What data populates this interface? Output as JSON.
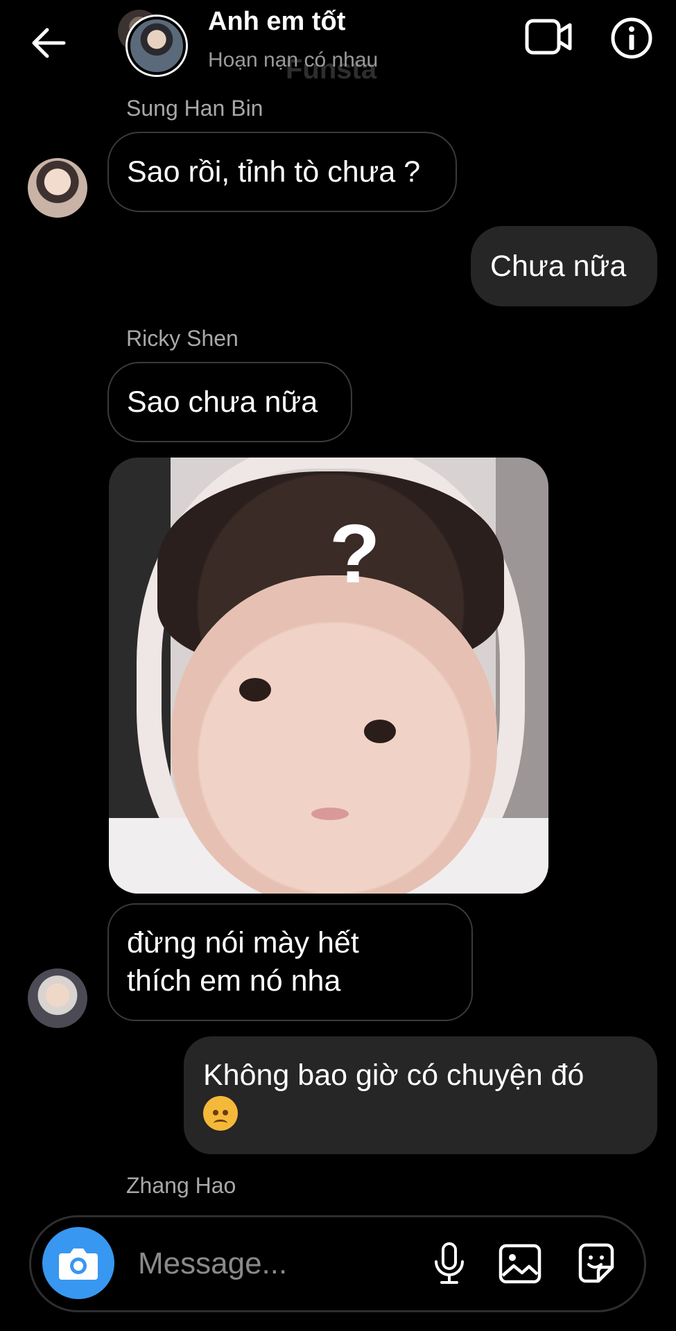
{
  "header": {
    "title": "Anh em tốt",
    "subtitle": "Hoạn nạn có nhau",
    "watermark": "Funsta"
  },
  "messages": {
    "m1": {
      "sender": "Sung Han Bin",
      "text": "Sao rồi, tỉnh tò chưa ?"
    },
    "m2": {
      "text": "Chưa nữa"
    },
    "m3": {
      "sender": "Ricky Shen",
      "text": "Sao chưa nữa"
    },
    "m5": {
      "text": "đừng nói mày hết thích em nó nha"
    },
    "m6": {
      "text": "Không bao giờ có chuyện đó"
    },
    "m7": {
      "sender": "Zhang Hao"
    }
  },
  "photo": {
    "overlay": "?"
  },
  "composer": {
    "placeholder": "Message..."
  },
  "icons": {
    "back": "arrow-left-icon",
    "video": "video-camera-icon",
    "info": "info-icon",
    "camera": "camera-icon",
    "mic": "microphone-icon",
    "gallery": "image-icon",
    "sticker": "sticker-icon",
    "emoji": "angry-face-emoji"
  },
  "colors": {
    "background": "#000000",
    "bubble_out": "#262626",
    "accent": "#3897f0",
    "secondary_text": "#a8a8a8"
  }
}
